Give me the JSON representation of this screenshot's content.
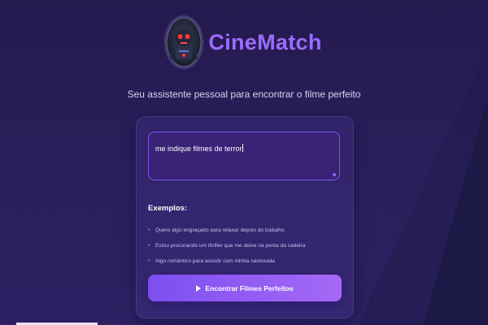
{
  "header": {
    "app_title": "CineMatch",
    "logo_icon": "robot-avatar-icon"
  },
  "subtitle": "Seu assistente pessoal para encontrar o filme perfeito",
  "query": {
    "value": "me indique filmes de terror"
  },
  "examples": {
    "title": "Exemplos:",
    "items": [
      "Quero algo engraçado para relaxar depois do trabalho",
      "Estou procurando um thriller que me deixe na ponta da cadeira",
      "Algo romântico para assistir com minha namorada"
    ]
  },
  "cta": {
    "label": "Encontrar Filmes Perfeitos",
    "icon": "play-icon"
  },
  "colors": {
    "background": "#2a1f5c",
    "accent": "#9b6cff",
    "button_start": "#7d4ff0",
    "button_end": "#a569f6",
    "dark_corner": "#14122e"
  }
}
